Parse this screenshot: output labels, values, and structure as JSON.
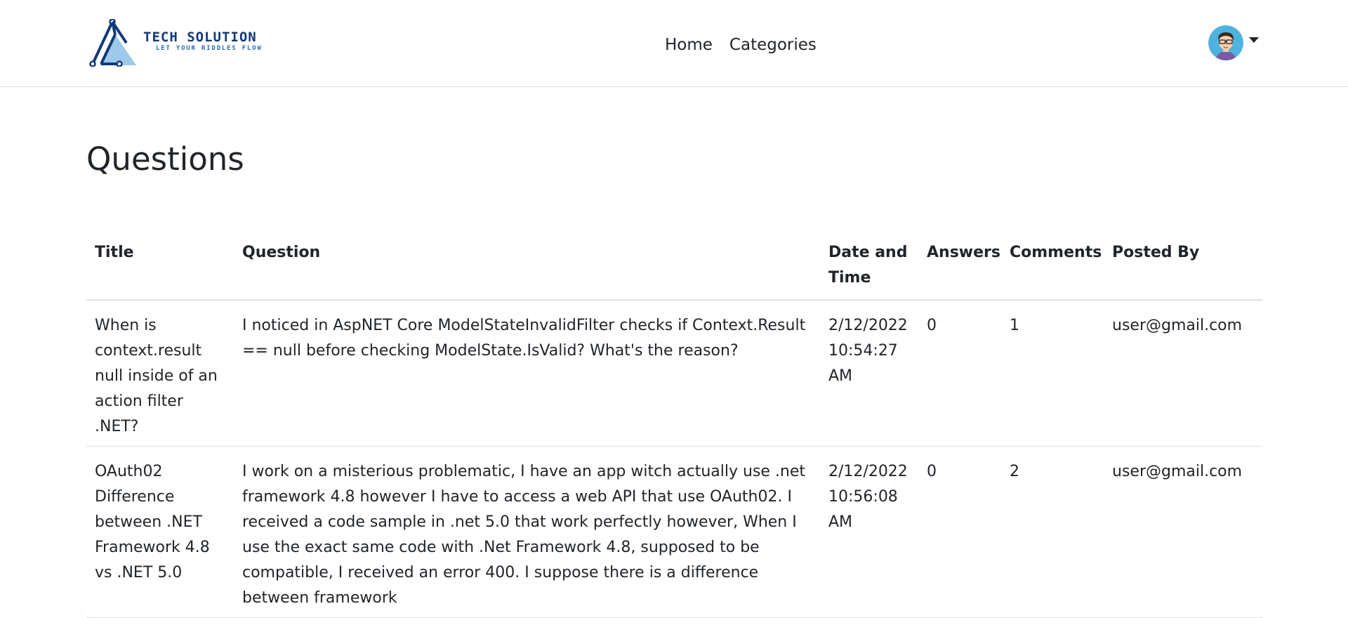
{
  "brand": {
    "name": "TECH SOLUTION",
    "tagline": "LET YOUR RIDDLES FLOW",
    "colors": {
      "primary": "#123a7a",
      "accent": "#2b6cb5",
      "light": "#9ec9e8"
    }
  },
  "nav": {
    "links": [
      {
        "label": "Home"
      },
      {
        "label": "Categories"
      }
    ]
  },
  "user_menu": {
    "avatar_icon": "user-avatar-icon",
    "caret_icon": "caret-down-icon"
  },
  "page": {
    "title": "Questions"
  },
  "table": {
    "headers": {
      "title": "Title",
      "question": "Question",
      "date": "Date and Time",
      "answers": "Answers",
      "comments": "Comments",
      "posted_by": "Posted By"
    },
    "rows": [
      {
        "title": "When is context.result null inside of an action filter .NET?",
        "question": "I noticed in AspNET Core ModelStateInvalidFilter checks if Context.Result == null before checking ModelState.IsValid? What's the reason?",
        "date": "2/12/2022 10:54:27 AM",
        "answers": "0",
        "comments": "1",
        "posted_by": "user@gmail.com"
      },
      {
        "title": "OAuth02 Difference between .NET Framework 4.8 vs .NET 5.0",
        "question": "I work on a misterious problematic, I have an app witch actually use .net framework 4.8 however I have to access a web API that use OAuth02. I received a code sample in .net 5.0 that work perfectly however, When I use the exact same code with .Net Framework 4.8, supposed to be compatible, I received an error 400. I suppose there is a difference between framework",
        "date": "2/12/2022 10:56:08 AM",
        "answers": "0",
        "comments": "2",
        "posted_by": "user@gmail.com"
      }
    ]
  }
}
